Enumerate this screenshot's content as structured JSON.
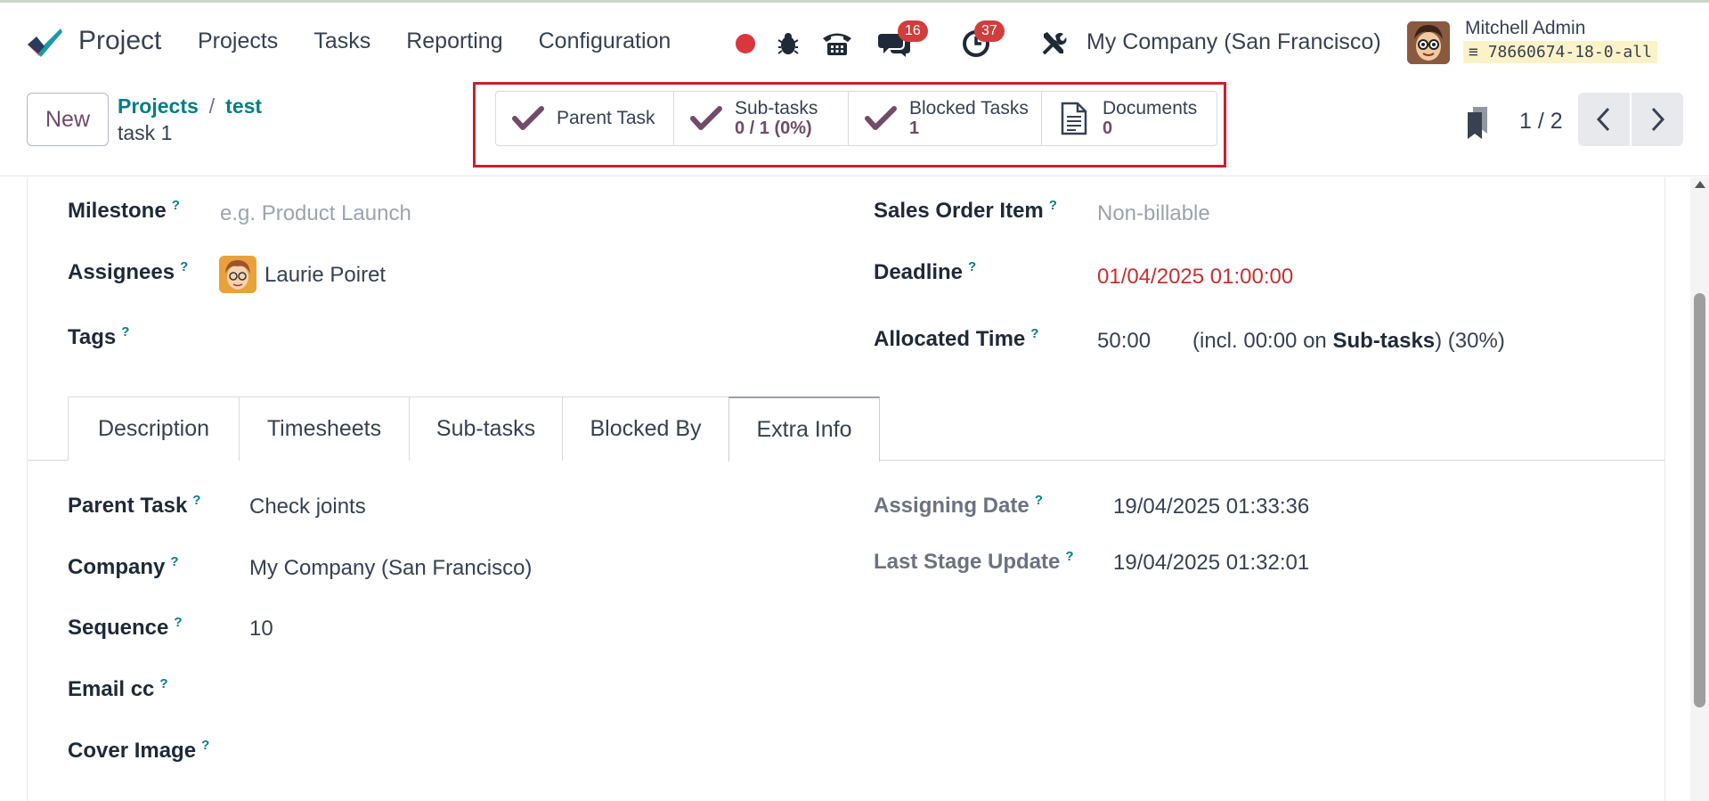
{
  "app": {
    "name": "Project"
  },
  "nav": {
    "items": [
      "Projects",
      "Tasks",
      "Reporting",
      "Configuration"
    ]
  },
  "systray": {
    "messages_count": "16",
    "activities_count": "37",
    "company": "My Company (San Francisco)",
    "user_name": "Mitchell Admin",
    "database": "78660674-18-0-all"
  },
  "control": {
    "new_label": "New",
    "breadcrumb": [
      "Projects",
      "test"
    ],
    "breadcrumb_sep": "/",
    "record_name": "task 1",
    "pager": "1 / 2"
  },
  "smart_buttons": [
    {
      "label": "Parent Task",
      "value": "",
      "icon": "check-icon"
    },
    {
      "label": "Sub-tasks",
      "value": "0 / 1 (0%)",
      "icon": "check-icon"
    },
    {
      "label": "Blocked Tasks",
      "value": "1",
      "icon": "check-icon"
    },
    {
      "label": "Documents",
      "value": "0",
      "icon": "document-icon"
    }
  ],
  "form": {
    "milestone": {
      "label": "Milestone",
      "placeholder": "e.g. Product Launch"
    },
    "assignees": {
      "label": "Assignees",
      "value": "Laurie Poiret"
    },
    "tags": {
      "label": "Tags"
    },
    "sales_order_item": {
      "label": "Sales Order Item",
      "placeholder": "Non-billable"
    },
    "deadline": {
      "label": "Deadline",
      "value": "01/04/2025 01:00:00"
    },
    "allocated_time": {
      "label": "Allocated Time",
      "value": "50:00",
      "note_prefix": "(incl. 00:00 on",
      "note_bold": "Sub-tasks",
      "note_suffix": ") (30%)"
    },
    "help_mark": "?"
  },
  "tabs": [
    "Description",
    "Timesheets",
    "Sub-tasks",
    "Blocked By",
    "Extra Info"
  ],
  "active_tab": "Extra Info",
  "extra_info": {
    "parent_task": {
      "label": "Parent Task",
      "value": "Check joints"
    },
    "company": {
      "label": "Company",
      "value": "My Company (San Francisco)"
    },
    "sequence": {
      "label": "Sequence",
      "value": "10"
    },
    "email_cc": {
      "label": "Email cc"
    },
    "cover_image": {
      "label": "Cover Image"
    },
    "assigning_date": {
      "label": "Assigning Date",
      "value": "19/04/2025 01:33:36"
    },
    "last_stage_update": {
      "label": "Last Stage Update",
      "value": "19/04/2025 01:32:01"
    }
  },
  "colors": {
    "brand": "#714b67",
    "link": "#017e84",
    "badge": "#d03d3d",
    "deadline": "#c53030",
    "highlight_frame": "#cc1f2a"
  }
}
